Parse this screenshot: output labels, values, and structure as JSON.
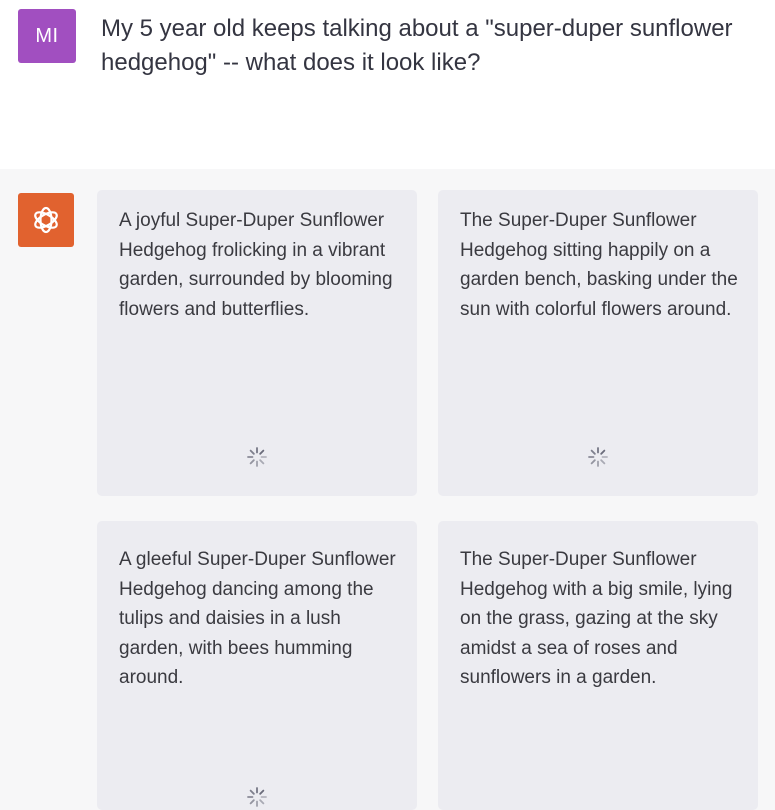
{
  "user": {
    "avatar_initials": "MI",
    "avatar_color": "#a14fc0",
    "message": "My 5 year old keeps talking about a \"super-duper sunflower hedgehog\" -- what does it look like?"
  },
  "assistant": {
    "avatar_icon": "openai-logo-icon",
    "avatar_color": "#e1622f",
    "cards": [
      {
        "prompt": "A joyful Super-Duper Sunflower Hedgehog frolicking in a vibrant garden, surrounded by blooming flowers and butterflies.",
        "status_icon": "loading-spinner-icon"
      },
      {
        "prompt": "The Super-Duper Sunflower Hedgehog sitting happily on a garden bench, basking under the sun with colorful flowers around.",
        "status_icon": "loading-spinner-icon"
      },
      {
        "prompt": "A gleeful Super-Duper Sunflower Hedgehog dancing among the tulips and daisies in a lush garden, with bees humming around.",
        "status_icon": "loading-spinner-icon"
      },
      {
        "prompt": "The Super-Duper Sunflower Hedgehog with a big smile, lying on the grass, gazing at the sky amidst a sea of roses and sunflowers in a garden.",
        "status_icon": "loading-spinner-icon"
      }
    ]
  }
}
